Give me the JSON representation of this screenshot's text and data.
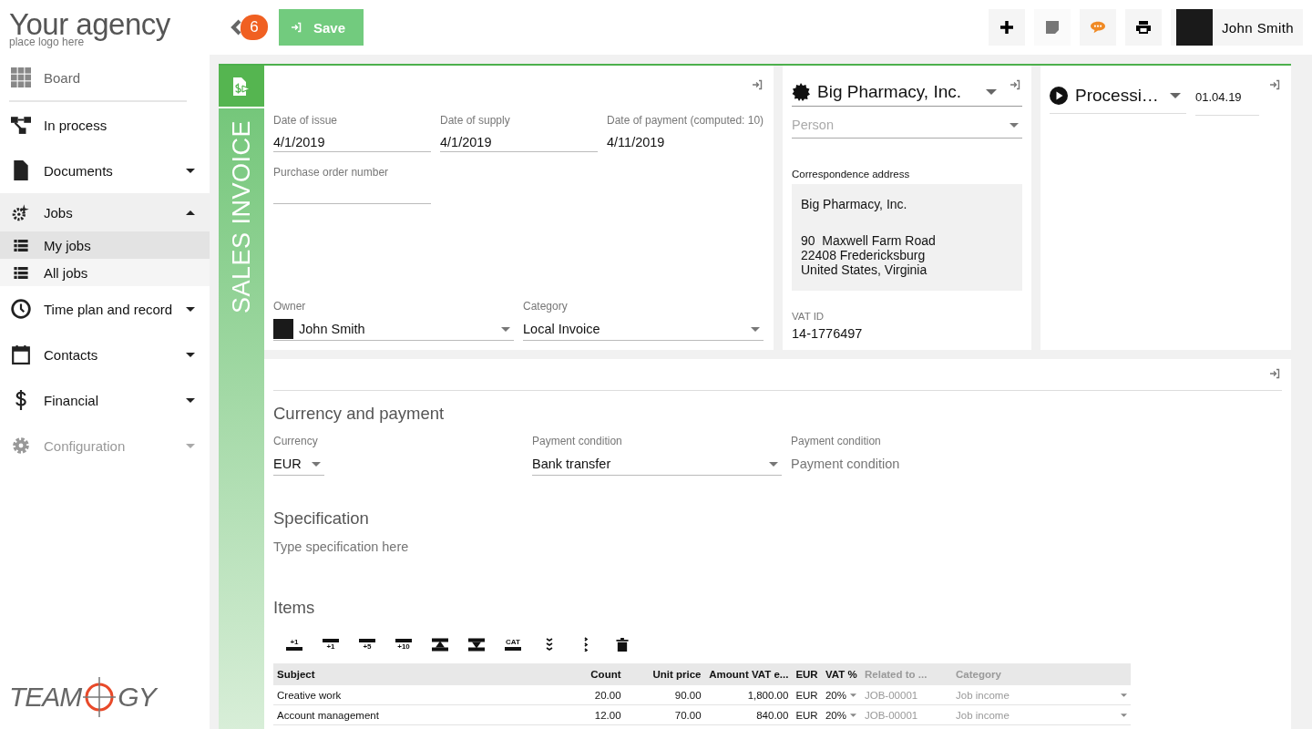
{
  "header": {
    "logo_title": "Your agency",
    "logo_subtitle": "place logo here",
    "badge": "6",
    "save_label": "Save",
    "tools": [
      {
        "kind": "add"
      },
      {
        "kind": "note"
      },
      {
        "kind": "chat"
      },
      {
        "kind": "print"
      }
    ],
    "user_name": "John Smith"
  },
  "sidebar": {
    "items": [
      {
        "kind": "grid",
        "label": "Board",
        "selected": false,
        "disabled": false
      },
      {
        "kind": "flow",
        "label": "In process",
        "selected": false,
        "disabled": false
      },
      {
        "kind": "document",
        "label": "Documents",
        "selected": false,
        "disabled": false,
        "expanded": false
      },
      {
        "kind": "jobs",
        "label": "Jobs",
        "selected": false,
        "disabled": false,
        "expanded": true,
        "children": [
          {
            "kind": "list",
            "label": "My jobs",
            "selected": true,
            "disabled": false
          },
          {
            "kind": "list",
            "label": "All jobs",
            "selected": false,
            "disabled": false
          }
        ]
      },
      {
        "kind": "clock",
        "label": "Time plan and record",
        "selected": false,
        "disabled": false,
        "expanded": false
      },
      {
        "kind": "calendar",
        "label": "Contacts",
        "selected": false,
        "disabled": false,
        "expanded": false
      },
      {
        "kind": "dollar",
        "label": "Financial",
        "selected": false,
        "disabled": false,
        "expanded": false
      },
      {
        "kind": "gear",
        "label": "Configuration",
        "selected": false,
        "disabled": true,
        "expanded": false
      }
    ],
    "footer_logo": {
      "left": "TEAM",
      "right": "GY"
    }
  },
  "invoice": {
    "type_label": "SALES INVOICE",
    "fields": [
      {
        "kind": "input",
        "label": "Date of issue",
        "value": "4/1/2019"
      },
      {
        "kind": "input",
        "label": "Date of supply",
        "value": "4/1/2019"
      },
      {
        "kind": "plain",
        "label": "Date of payment (computed: 10)",
        "value": "4/11/2019"
      },
      {
        "kind": "input",
        "label": "Purchase order number"
      }
    ],
    "owner": {
      "label": "Owner",
      "value": "John Smith"
    },
    "category": {
      "label": "Category",
      "value": "Local Invoice"
    }
  },
  "customer": {
    "name": "Big Pharmacy, Inc.",
    "person_placeholder": "Person",
    "address_label": "Correspondence address",
    "address_name": "Big Pharmacy, Inc.",
    "address_lines": [
      "90  Maxwell Farm Road",
      "22408 Fredericksburg",
      "United States, Virginia"
    ],
    "vat_label": "VAT ID",
    "vat": "14-1776497"
  },
  "status": {
    "label": "Processi…",
    "date": "01.04.19"
  },
  "payment": {
    "title": "Currency and payment",
    "currency": {
      "label": "Currency",
      "value": "EUR"
    },
    "condition": {
      "label": "Payment condition",
      "value": "Bank transfer"
    },
    "condition_extra": {
      "label": "Payment condition",
      "placeholder": "Payment condition"
    }
  },
  "specification": {
    "title": "Specification",
    "placeholder": "Type specification here"
  },
  "items": {
    "title": "Items",
    "tools": [
      {
        "kind": "bar-label-above",
        "label": "+1"
      },
      {
        "kind": "bar-label-below",
        "label": "+1"
      },
      {
        "kind": "bar-label-below",
        "label": "+5"
      },
      {
        "kind": "bar-label-below",
        "label": "+10"
      },
      {
        "kind": "move-up"
      },
      {
        "kind": "move-down"
      },
      {
        "kind": "bar-label-above",
        "label": "CAT"
      },
      {
        "kind": "chevrons-down"
      },
      {
        "kind": "dots-vertical"
      },
      {
        "kind": "trash"
      }
    ],
    "columns": [
      {
        "label": "Subject",
        "muted": false
      },
      {
        "label": "Count",
        "muted": false
      },
      {
        "label": "Unit price",
        "muted": false
      },
      {
        "label": "Amount VAT e...",
        "muted": false
      },
      {
        "label": "EUR",
        "muted": false
      },
      {
        "label": "VAT %",
        "muted": false
      },
      {
        "label": "Related to ...",
        "muted": true
      },
      {
        "label": "Category",
        "muted": true
      }
    ],
    "rows": [
      {
        "subject": "Creative work",
        "count": "20.00",
        "unit_price": "90.00",
        "amount": "1,800.00",
        "currency": "EUR",
        "vat": "20%",
        "related": "JOB-00001",
        "category": "Job income"
      },
      {
        "subject": "Account management",
        "count": "12.00",
        "unit_price": "70.00",
        "amount": "840.00",
        "currency": "EUR",
        "vat": "20%",
        "related": "JOB-00001",
        "category": "Job income"
      }
    ]
  }
}
